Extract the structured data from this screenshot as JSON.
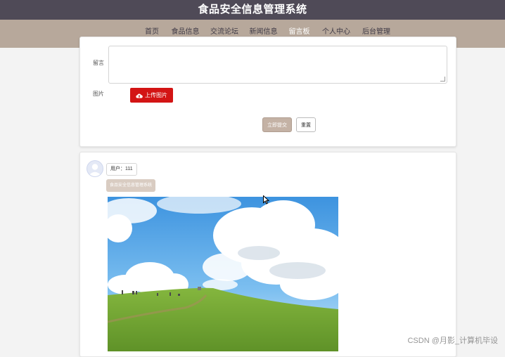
{
  "header": {
    "site_title": "食品安全信息管理系统"
  },
  "nav": {
    "items": [
      {
        "label": "首页"
      },
      {
        "label": "食品信息"
      },
      {
        "label": "交流论坛"
      },
      {
        "label": "新闻信息"
      },
      {
        "label": "留言板"
      },
      {
        "label": "个人中心"
      },
      {
        "label": "后台管理"
      }
    ],
    "active_index": 4
  },
  "form": {
    "message_label": "留言",
    "image_label": "图片",
    "upload_label": "上传图片",
    "submit_label": "立即提交",
    "reset_label": "重置"
  },
  "messages": [
    {
      "user": "用户：111",
      "content": "食品安全信息管理系统",
      "image": "landscape photo: blue sky with clouds over green grassy hill"
    }
  ],
  "watermark": "CSDN @月影_计算机毕设",
  "colors": {
    "header_bg": "#4f4a57",
    "nav_bg": "#b7a89b",
    "upload_red": "#d31414",
    "submit_beige": "#c4b2a5"
  }
}
